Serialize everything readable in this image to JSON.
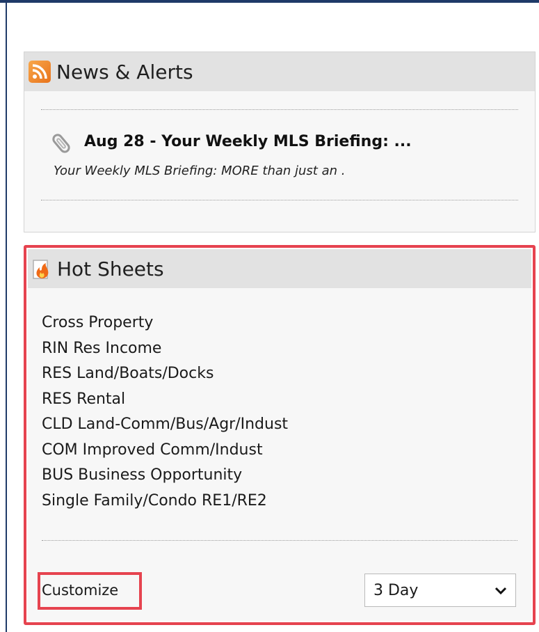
{
  "news": {
    "title": "News & Alerts",
    "icon": "rss-icon",
    "items": [
      {
        "headline": "Aug 28 - Your Weekly MLS Briefing: ...",
        "snippet": "Your Weekly MLS Briefing:  MORE  than just an ."
      }
    ]
  },
  "hotsheets": {
    "title": "Hot Sheets",
    "icon": "flame-icon",
    "items": [
      "Cross Property",
      "RIN Res Income",
      "RES Land/Boats/Docks",
      "RES Rental",
      "CLD Land-Comm/Bus/Agr/Indust",
      "COM Improved Comm/Indust",
      "BUS Business Opportunity",
      "Single Family/Condo RE1/RE2"
    ],
    "customize_label": "Customize",
    "range_value": "3 Day"
  },
  "colors": {
    "highlight": "#e6434f",
    "frame": "#1f3a68",
    "panel_header": "#e2e2e2"
  }
}
